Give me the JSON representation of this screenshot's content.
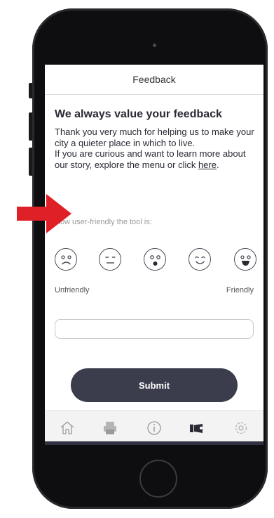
{
  "header": {
    "title": "Feedback"
  },
  "main": {
    "heading": "We always value your feedback",
    "paragraph_1": "Thank you very much for helping us to make your city a quieter place in which to live.",
    "paragraph_2_prefix": "If you are curious and want to learn more about our story, explore the menu or click ",
    "paragraph_2_link": "here",
    "paragraph_2_suffix": ".",
    "rating_label": "How user-friendly the tool is:",
    "faces": [
      {
        "name": "very-unfriendly-face-icon"
      },
      {
        "name": "unfriendly-face-icon"
      },
      {
        "name": "neutral-face-icon"
      },
      {
        "name": "friendly-face-icon"
      },
      {
        "name": "very-friendly-face-icon"
      }
    ],
    "scale_left": "Unfriendly",
    "scale_right": "Friendly",
    "comment_placeholder": "",
    "submit_label": "Submit"
  },
  "tabbar": {
    "items": [
      {
        "icon": "home-icon",
        "active": false
      },
      {
        "icon": "printer-icon",
        "active": false
      },
      {
        "icon": "info-icon",
        "active": false
      },
      {
        "icon": "feedback-icon",
        "active": true
      },
      {
        "icon": "gear-icon",
        "active": false
      }
    ]
  },
  "annotation": {
    "arrow_color": "#e02027"
  },
  "colors": {
    "accent": "#3b3d4d",
    "text": "#2a2a35"
  }
}
